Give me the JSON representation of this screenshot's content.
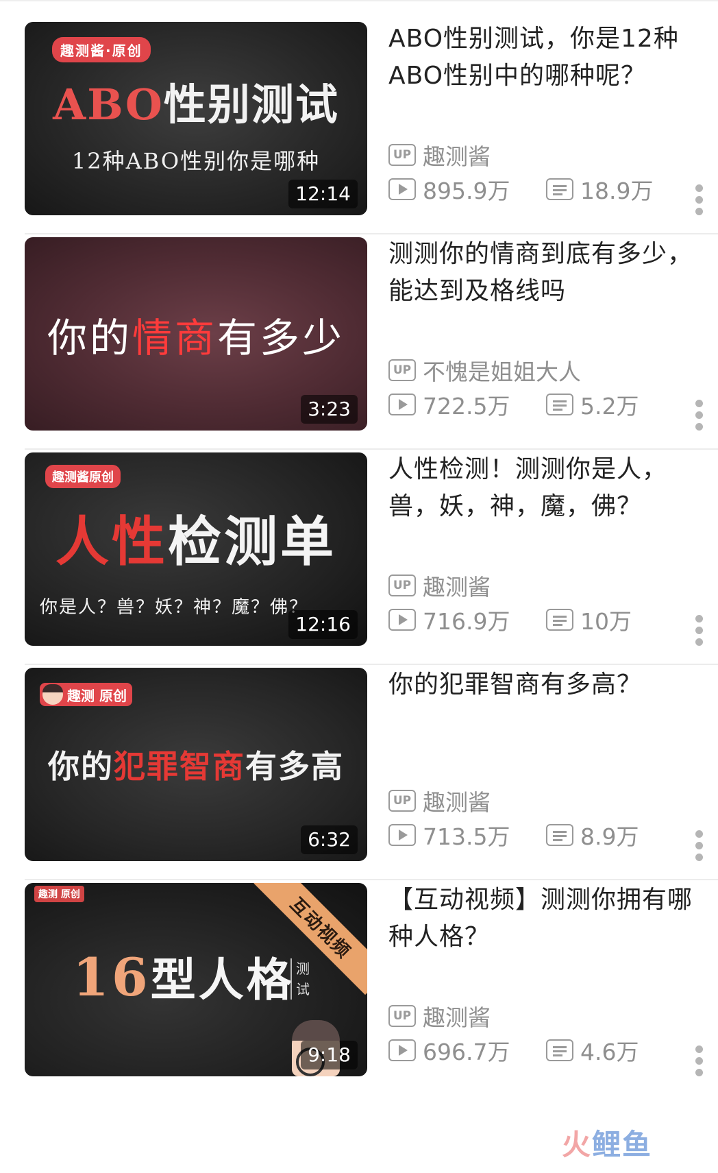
{
  "videos": [
    {
      "title": "ABO性别测试，你是12种ABO性别中的哪种呢？",
      "uploader": "趣测酱",
      "views": "895.9万",
      "danmaku": "18.9万",
      "duration": "12:14",
      "thumb": {
        "badge": "趣测酱·原创",
        "title_red": "ABO",
        "title_white": "性别测试",
        "subtitle": "12种ABO性别你是哪种"
      }
    },
    {
      "title": "测测你的情商到底有多少，能达到及格线吗",
      "uploader": "不愧是姐姐大人",
      "views": "722.5万",
      "danmaku": "5.2万",
      "duration": "3:23",
      "thumb": {
        "title_a": "你的",
        "title_red": "情商",
        "title_b": "有多少"
      }
    },
    {
      "title": "人性检测！测测你是人，兽，妖，神，魔，佛？",
      "uploader": "趣测酱",
      "views": "716.9万",
      "danmaku": "10万",
      "duration": "12:16",
      "thumb": {
        "badge": "趣测酱原创",
        "title_red": "人性",
        "title_white": "检测单",
        "subtitle": "你是人？兽？妖？神？魔？佛？"
      }
    },
    {
      "title": "你的犯罪智商有多高？",
      "uploader": "趣测酱",
      "views": "713.5万",
      "danmaku": "8.9万",
      "duration": "6:32",
      "thumb": {
        "logo": "趣测 原创",
        "title_a": "你的",
        "title_red": "犯罪智商",
        "title_b": "有多高"
      }
    },
    {
      "title": "【互动视频】测测你拥有哪种人格？",
      "uploader": "趣测酱",
      "views": "696.7万",
      "danmaku": "4.6万",
      "duration": "9:18",
      "thumb": {
        "logo": "趣测 原创",
        "ribbon": "互动视频",
        "title_num": "16",
        "title_text": "型人格",
        "side": "测试"
      }
    }
  ],
  "icons": {
    "up": "UP",
    "play": "play-icon",
    "danmaku": "danmaku-icon",
    "more": "more-vertical-icon"
  },
  "watermark": {
    "a": "火",
    "b": "鲤鱼"
  }
}
